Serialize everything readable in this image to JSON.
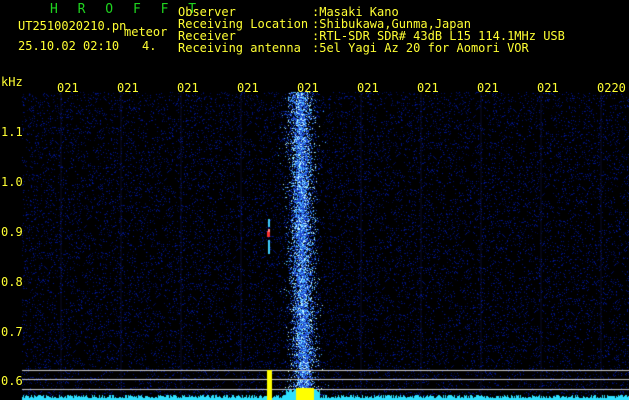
{
  "header": {
    "title": "H R O F F T",
    "filename": "UT2510020210.pn",
    "mode": "meteor",
    "datetime": "25.10.02 02:10",
    "count": "4.",
    "info_labels": [
      "Observer",
      "Receiving Location",
      "Receiver",
      "Receiving antenna"
    ],
    "info_values": [
      ":Masaki Kano",
      ":Shibukawa,Gunma,Japan",
      ":RTL-SDR SDR# 43dB L15 114.1MHz USB",
      ":5el Yagi Az 20 for Aomori VOR"
    ]
  },
  "axes": {
    "y_unit": "kHz",
    "y_ticks": [
      "1.1",
      "1.0",
      "0.9",
      "0.8",
      "0.7",
      "0.6"
    ],
    "time_ticks": [
      "021",
      "021",
      "021",
      "021",
      "021",
      "021",
      "021",
      "021",
      "021",
      "0220"
    ]
  },
  "colors": {
    "label": "#ffff33",
    "title": "#1fd41f",
    "noise": "#1a2fae",
    "echo": "#7fe0ff",
    "baseline": "#2ee0ff",
    "guide_lines": "#c8c8c8"
  }
}
